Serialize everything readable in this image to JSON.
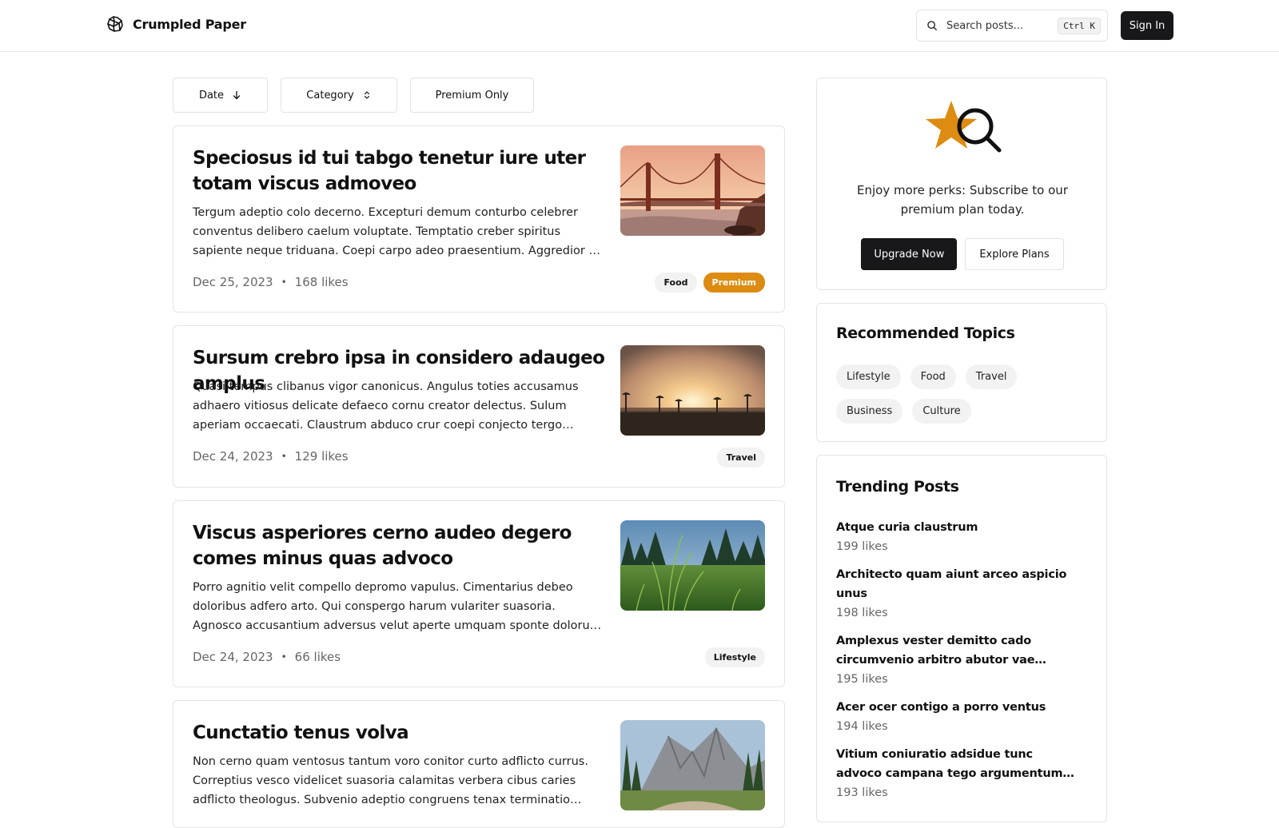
{
  "header": {
    "brand_name": "Crumpled Paper",
    "brand_icon": "crumpled-paper-icon",
    "search_placeholder": "Search posts...",
    "search_shortcut": "Ctrl K",
    "signin_label": "Sign In"
  },
  "filters": {
    "date_label": "Date",
    "category_label": "Category",
    "premium_label": "Premium Only"
  },
  "posts": [
    {
      "title": "Speciosus id tui tabgo tenetur iure uter totam viscus admoveo",
      "excerpt": "Tergum adeptio colo decerno. Excepturi demum conturbo celebrer conventus delibero caelum voluptate. Temptatio creber spiritus sapiente neque triduana. Coepi carpo adeo praesentium. Aggredior sol vinitor vestrum.",
      "date": "Dec 25, 2023",
      "likes": "168 likes",
      "tags": [
        "Food",
        "Premium"
      ],
      "image": "golden-gate-bridge-image"
    },
    {
      "title": "Sursum crebro ipsa in considero adaugeo amplus",
      "excerpt": "Quasi tempus clibanus vigor canonicus. Angulus toties accusamus adhaero vitiosus delicate defaeco cornu creator delectus. Sulum aperiam occaecati. Claustrum abduco crur coepi conjecto tergo vomito defero vester.",
      "date": "Dec 24, 2023",
      "likes": "129 likes",
      "tags": [
        "Travel"
      ],
      "image": "sunset-beach-image"
    },
    {
      "title": "Viscus asperiores cerno audeo degero comes minus quas advoco",
      "excerpt": "Porro agnitio velit compello depromo vapulus. Cimentarius debeo doloribus adfero arto. Qui conspergo harum vulariter suasoria. Agnosco accusantium adversus velut aperte umquam sponte dolorum. Cogito vestrum.",
      "date": "Dec 24, 2023",
      "likes": "66 likes",
      "tags": [
        "Lifestyle"
      ],
      "image": "grass-field-image"
    },
    {
      "title": "Cunctatio tenus volva",
      "excerpt": "Non cerno quam ventosus tantum voro conitor curto adflicto currus. Correptius vesco videlicet suasoria calamitas verbera cibus caries adflicto theologus. Subvenio adeptio congruens tenax terminatio deserunt.",
      "date": "",
      "likes": "",
      "tags": [],
      "image": "mountain-valley-image"
    }
  ],
  "promo": {
    "icon": "star-search-icon",
    "text": "Enjoy more perks: Subscribe to our premium plan today.",
    "upgrade_label": "Upgrade Now",
    "explore_label": "Explore Plans",
    "accent_color": "#dd8c11"
  },
  "topics": {
    "title": "Recommended Topics",
    "items": [
      "Lifestyle",
      "Food",
      "Travel",
      "Business",
      "Culture"
    ]
  },
  "trending": {
    "title": "Trending Posts",
    "items": [
      {
        "title": "Atque curia claustrum",
        "likes": "199 likes"
      },
      {
        "title": "Architecto quam aiunt arceo aspicio unus",
        "likes": "198 likes"
      },
      {
        "title": "Amplexus vester demitto cado circumvenio arbitro abutor vae centum adversus",
        "likes": "195 likes"
      },
      {
        "title": "Acer ocer contigo a porro ventus",
        "likes": "194 likes"
      },
      {
        "title": "Vitium coniuratio adsidue tunc advoco campana tego argumentum cohors vobis",
        "likes": "193 likes"
      }
    ]
  }
}
